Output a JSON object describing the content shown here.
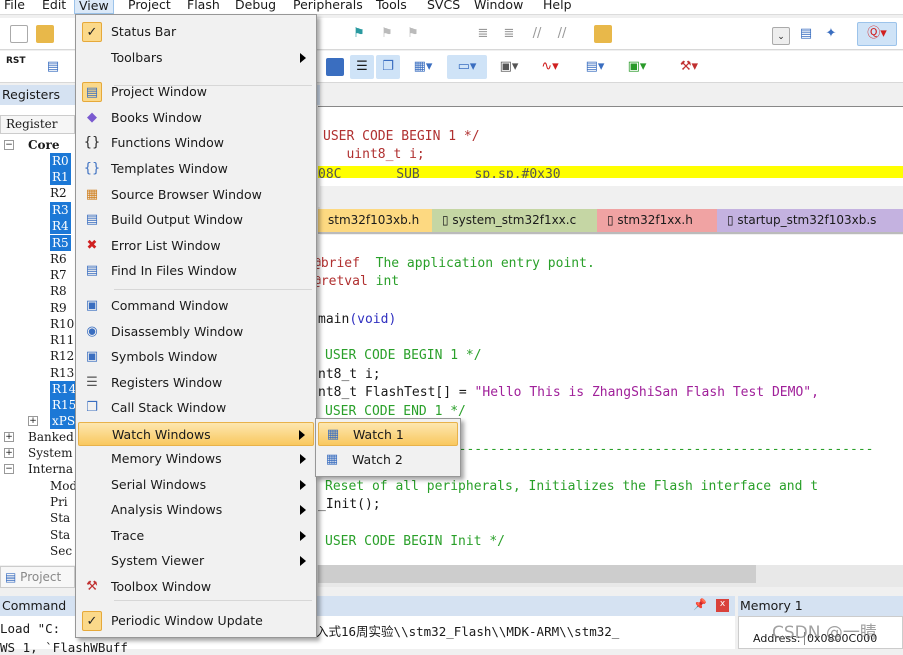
{
  "menubar": [
    "File",
    "Edit",
    "View",
    "Project",
    "Flash",
    "Debug",
    "Peripherals",
    "Tools",
    "SVCS",
    "Window",
    "Help"
  ],
  "toolbar": {
    "rst_label": "RST"
  },
  "registers": {
    "title": "Registers",
    "column": "Register",
    "tree": [
      "Core",
      "R0",
      "R1",
      "R2",
      "R3",
      "R4",
      "R5",
      "R6",
      "R7",
      "R8",
      "R9",
      "R10",
      "R11",
      "R12",
      "R13",
      "R14",
      "R15",
      "xPSR",
      "Banked",
      "System",
      "Interna",
      "Mode",
      "Pri",
      "Sta",
      "Sta",
      "Sec"
    ],
    "selected": [
      "R0",
      "R1",
      "R3",
      "R4",
      "R5",
      "R14",
      "R15",
      "xPSR"
    ]
  },
  "project_tab": "Project",
  "command": {
    "title": "Command",
    "lines": [
      "Load \"C:",
      "WS 1, `FlashWBuff"
    ],
    "path": "入式16周实验\\\\stm32_Flash\\\\MDK-ARM\\\\stm32_"
  },
  "memory": {
    "title": "Memory 1",
    "address_label": "Address:",
    "address_value": "0x0800C000"
  },
  "disassembly": {
    "line1": "USER CODE BEGIN 1 */",
    "line2": "   uint8_t i;",
    "current": "08C       SUB       sp,sp,#0x30"
  },
  "tabs": [
    {
      "label": "stm32f103xb.h",
      "color": "#fdd981"
    },
    {
      "label": "system_stm32f1xx.c",
      "color": "#c5d6a4"
    },
    {
      "label": "stm32f1xx.h",
      "color": "#f0a3a3"
    },
    {
      "label": "startup_stm32f103xb.s",
      "color": "#c4b2e0"
    }
  ],
  "code": {
    "brief_tag": "@brief",
    "brief_text": "  The application entry point.",
    "retval_tag": "@retval",
    "retval_text": " int",
    "main": "main",
    "void": "(void)",
    "ucb1": "USER CODE BEGIN 1 */",
    "l_i": "nt8_t i;",
    "l_flash": "nt8_t FlashTest[] = ",
    "str": "\"Hello This is ZhangShiSan Flash Test DEMO\",",
    "uce1": "USER CODE END 1 */",
    "dash": "on-----------------------------------------------------",
    "reset": "Reset of all peripherals, Initializes the Flash interface and t",
    "init": "_Init();",
    "ucbi": "USER CODE BEGIN Init */"
  },
  "view_menu": [
    {
      "label": "Status Bar",
      "icon": "checkmark-icon",
      "checked": true
    },
    {
      "label": "Toolbars",
      "submenu": true
    },
    {
      "label": "Project Window",
      "icon": "project-window-icon",
      "checked": true
    },
    {
      "label": "Books Window",
      "icon": "books-icon"
    },
    {
      "label": "Functions Window",
      "icon": "braces-icon"
    },
    {
      "label": "Templates Window",
      "icon": "templates-icon"
    },
    {
      "label": "Source Browser Window",
      "icon": "source-browser-icon"
    },
    {
      "label": "Build Output Window",
      "icon": "build-output-icon"
    },
    {
      "label": "Error List Window",
      "icon": "error-icon"
    },
    {
      "label": "Find In Files Window",
      "icon": "find-in-files-icon"
    },
    {
      "label": "Command Window",
      "icon": "command-icon"
    },
    {
      "label": "Disassembly Window",
      "icon": "disassembly-icon"
    },
    {
      "label": "Symbols Window",
      "icon": "symbols-icon"
    },
    {
      "label": "Registers Window",
      "icon": "registers-icon"
    },
    {
      "label": "Call Stack Window",
      "icon": "call-stack-icon"
    },
    {
      "label": "Watch Windows",
      "submenu": true,
      "highlighted": true
    },
    {
      "label": "Memory Windows",
      "submenu": true
    },
    {
      "label": "Serial Windows",
      "submenu": true
    },
    {
      "label": "Analysis Windows",
      "submenu": true
    },
    {
      "label": "Trace",
      "submenu": true
    },
    {
      "label": "System Viewer",
      "submenu": true
    },
    {
      "label": "Toolbox Window",
      "icon": "toolbox-icon"
    },
    {
      "label": "Periodic Window Update",
      "icon": "checkmark-icon",
      "checked": true
    }
  ],
  "watch_submenu": [
    {
      "label": "Watch 1",
      "highlighted": true
    },
    {
      "label": "Watch 2"
    }
  ],
  "watermark": "CSDN @一睛"
}
